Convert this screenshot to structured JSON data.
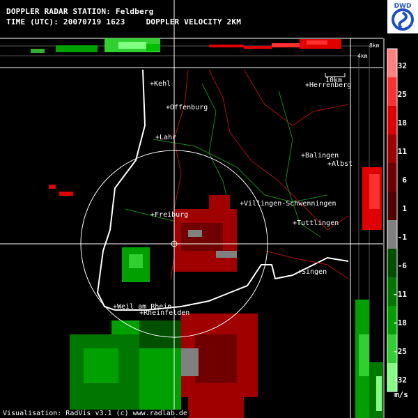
{
  "header": {
    "station_line": "DOPPLER RADAR STATION: Feldberg",
    "time_line": "TIME (UTC): 20070719 1623",
    "product": "DOPPLER VELOCITY 2KM"
  },
  "logo": {
    "text": "DWD",
    "icon": "dwd-logo-icon"
  },
  "cities": [
    {
      "name": "Kehl"
    },
    {
      "name": "Offenburg"
    },
    {
      "name": "Lahr"
    },
    {
      "name": "Herrenberg"
    },
    {
      "name": "Balingen"
    },
    {
      "name": "Albst"
    },
    {
      "name": "Villingen-Schwenningen"
    },
    {
      "name": "Freiburg"
    },
    {
      "name": "Tuttlingen"
    },
    {
      "name": "Singen"
    },
    {
      "name": "Weil am Rhein"
    },
    {
      "name": "Rheinfelden"
    }
  ],
  "scale_bar": {
    "label": "10km"
  },
  "altitude_markers": {
    "top": "8km",
    "mid": "4km"
  },
  "colorbar": {
    "unit": "m/s",
    "labels": [
      "32",
      "25",
      "18",
      "11",
      "6",
      "1",
      "-1",
      "-6",
      "-11",
      "-18",
      "-25",
      "-32"
    ],
    "colors": [
      "#ff8080",
      "#ff3030",
      "#e00000",
      "#a00000",
      "#700000",
      "#500000",
      "#808080",
      "#005000",
      "#007800",
      "#00a000",
      "#30d030",
      "#80ff80"
    ]
  },
  "credit": "Visualisation: RadVis v3.1 (c) www.radlab.de"
}
